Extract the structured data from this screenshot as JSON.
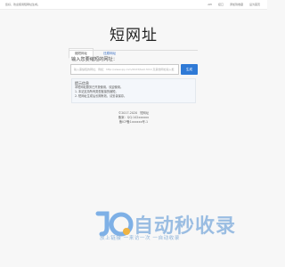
{
  "topbar": {
    "welcome": "您好，欢迎使用短网址生成。",
    "links": [
      "API",
      "接口",
      "添加到收藏",
      "设为首页"
    ]
  },
  "title": "短网址",
  "tabs": [
    {
      "label": "缩短网址",
      "active": true
    },
    {
      "label": "还原网址",
      "active": false
    }
  ],
  "form": {
    "prompt": "输入您要缩短的网址：",
    "input_placeholder": "输入需缩短的网址，例如：http://www.qq.com/2023/test.html 及其他网址输入框",
    "button_label": "生成"
  },
  "tips": {
    "title": "提示信息",
    "lines": [
      "本短网址服务已开放使用，欢迎使用。",
      "1. 本站支持所有类型链接的缩短。",
      "2. 短网址生成后长期有效，请妥善保存。"
    ]
  },
  "footer": {
    "copyright": "©2017-2020",
    "brand": "短网址",
    "line2": "备案：QQ:142xxxxxx",
    "line3": "备ICP备1xxxxxx号-1"
  },
  "watermark": {
    "title": "自动秒收录",
    "slogan": "放上链接 一来访一次 一自动收录",
    "colors": {
      "primary": "#7eb0e6",
      "secondary": "#f0b443"
    }
  }
}
